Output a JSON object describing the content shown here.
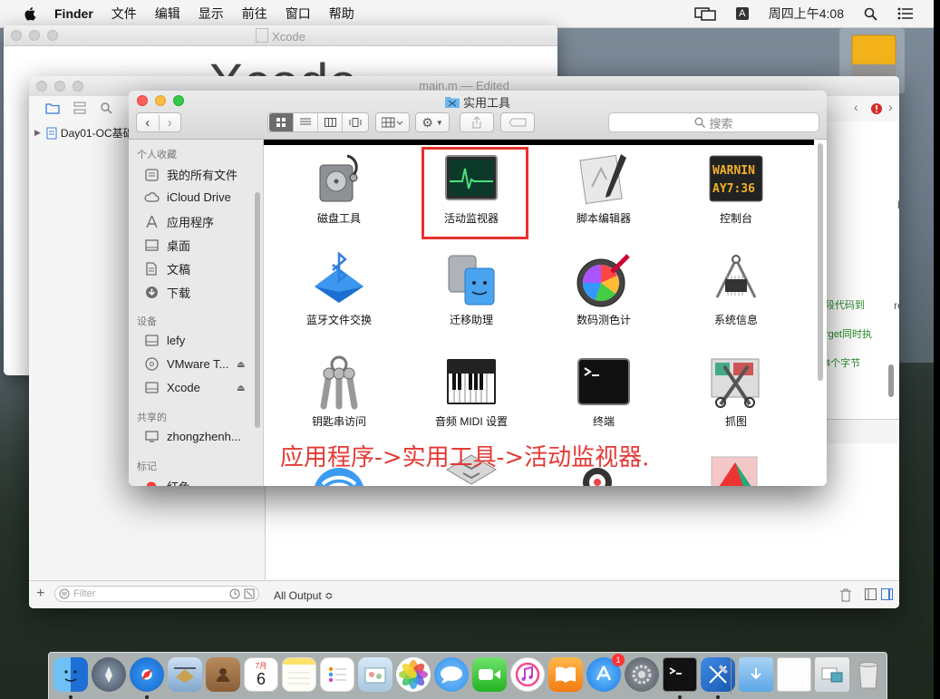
{
  "menubar": {
    "app": "Finder",
    "items": [
      "文件",
      "编辑",
      "显示",
      "前往",
      "窗口",
      "帮助"
    ],
    "input_badge": "A",
    "clock": "周四上午4:08"
  },
  "xcode_window": {
    "title": "Xcode",
    "big_title": "Xcode"
  },
  "editor_window": {
    "title": "main.m — Edited",
    "nav_item": "Day01-OC基础",
    "code_fragments": [
      "段代码到",
      "rget同时执",
      "4个字节"
    ],
    "side_fragments": [
      "ls",
      "red"
    ],
    "filter_placeholder": "Filter",
    "output_label": "All Output ≎"
  },
  "finder": {
    "title": "实用工具",
    "search_placeholder": "搜索",
    "sidebar": {
      "favorites_header": "个人收藏",
      "favorites": [
        {
          "label": "我的所有文件",
          "icon": "all-files-icon"
        },
        {
          "label": "iCloud Drive",
          "icon": "cloud-icon"
        },
        {
          "label": "应用程序",
          "icon": "applications-icon"
        },
        {
          "label": "桌面",
          "icon": "desktop-icon"
        },
        {
          "label": "文稿",
          "icon": "documents-icon"
        },
        {
          "label": "下载",
          "icon": "downloads-icon"
        }
      ],
      "devices_header": "设备",
      "devices": [
        {
          "label": "lefy",
          "icon": "disk-icon"
        },
        {
          "label": "VMware T...",
          "icon": "cd-icon"
        },
        {
          "label": "Xcode",
          "icon": "disk-icon"
        }
      ],
      "shared_header": "共享的",
      "shared": [
        {
          "label": "zhongzhenh...",
          "icon": "computer-icon"
        }
      ],
      "tags_header": "标记",
      "tags": [
        {
          "label": "红色",
          "color": "#fc3d39"
        }
      ]
    },
    "apps": [
      {
        "label": "磁盘工具",
        "icon": "disk-utility-icon"
      },
      {
        "label": "活动监视器",
        "icon": "activity-monitor-icon"
      },
      {
        "label": "脚本编辑器",
        "icon": "script-editor-icon"
      },
      {
        "label": "控制台",
        "icon": "console-icon"
      },
      {
        "label": "蓝牙文件交换",
        "icon": "bluetooth-icon"
      },
      {
        "label": "迁移助理",
        "icon": "migration-assistant-icon"
      },
      {
        "label": "数码测色计",
        "icon": "color-meter-icon"
      },
      {
        "label": "系统信息",
        "icon": "system-info-icon"
      },
      {
        "label": "钥匙串访问",
        "icon": "keychain-icon"
      },
      {
        "label": "音频 MIDI 设置",
        "icon": "midi-icon"
      },
      {
        "label": "终端",
        "icon": "terminal-icon"
      },
      {
        "label": "抓图",
        "icon": "grab-icon"
      }
    ],
    "console_text_top": "WARNIN",
    "console_text_bottom": "AY7:36",
    "annotation": "应用程序->实用工具->活动监视器."
  },
  "dock": {
    "calendar_month": "7月",
    "calendar_day": "6",
    "appstore_badge": "1",
    "colors": {
      "finder": "#3d8fe6",
      "launchpad": "#5b6370",
      "safari": "#2e8ff0",
      "mail": "#7a9cbf"
    }
  }
}
